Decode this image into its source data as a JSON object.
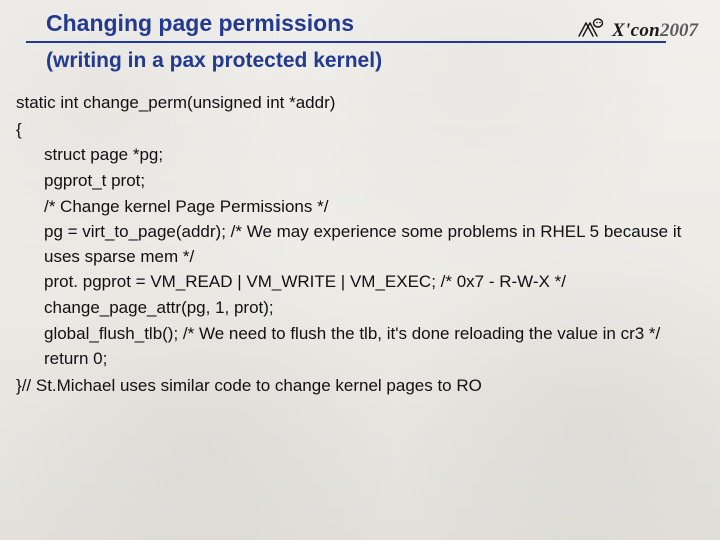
{
  "logo": {
    "brand": "X'con",
    "year": "2007",
    "icon_name": "xcon-mascot-icon"
  },
  "title": "Changing page permissions",
  "subtitle": "(writing in a pax protected kernel)",
  "code": {
    "signature": "static int change_perm(unsigned int *addr)",
    "brace_open": "{",
    "lines": [
      "struct page *pg;",
      "pgprot_t prot;",
      "/* Change kernel Page Permissions  */",
      "pg = virt_to_page(addr); /* We may experience some problems in RHEL 5 because it uses sparse mem */",
      "prot. pgprot = VM_READ | VM_WRITE | VM_EXEC; /* 0x7 - R-W-X */",
      "change_page_attr(pg, 1, prot);",
      "global_flush_tlb(); /* We need to flush the tlb, it's done reloading the value in cr3 */",
      "return 0;"
    ],
    "brace_close": "}",
    "trailing_comment": "// St.Michael uses similar code to change kernel pages to RO"
  },
  "colors": {
    "heading": "#233a8f",
    "text": "#111111",
    "background_top": "#f2f0ec",
    "background_bottom": "#e2e0d9"
  }
}
